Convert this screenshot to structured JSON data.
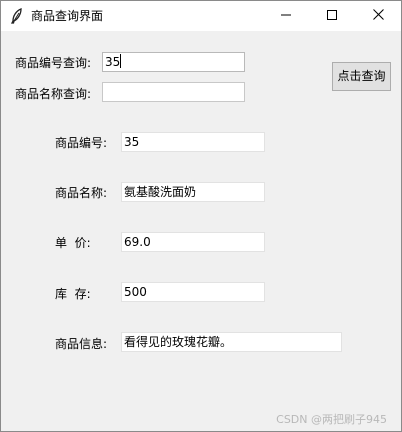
{
  "window": {
    "title": "商品查询界面"
  },
  "search": {
    "id_label": "商品编号查询:",
    "id_value": "35",
    "name_label": "商品名称查询:",
    "name_value": "",
    "button_label": "点击查询"
  },
  "details": {
    "id_label": "商品编号:",
    "id_value": "35",
    "name_label": "商品名称:",
    "name_value": "氨基酸洗面奶",
    "price_label": "单  价:",
    "price_value": "69.0",
    "stock_label": "库  存:",
    "stock_value": "500",
    "info_label": "商品信息:",
    "info_value": "看得见的玫瑰花瓣。"
  },
  "watermark": "CSDN @两把刷子945",
  "icons": {
    "app": "feather-icon",
    "minimize": "minimize-icon",
    "maximize": "maximize-icon",
    "close": "close-icon"
  }
}
